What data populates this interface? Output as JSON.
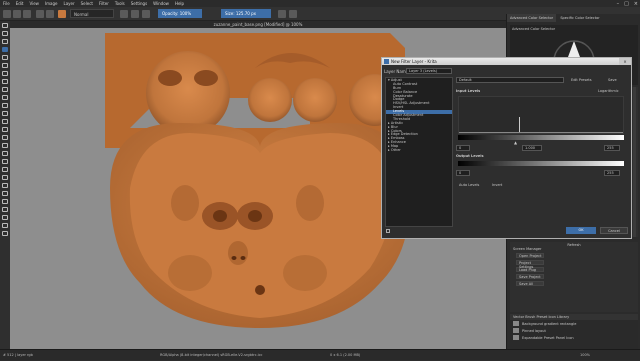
{
  "menu": [
    "File",
    "Edit",
    "View",
    "Image",
    "Layer",
    "Select",
    "Filter",
    "Tools",
    "Settings",
    "Window",
    "Help"
  ],
  "toolbar": {
    "blend_mode": "Normal",
    "opacity": "Opacity: 100%",
    "size": "Size: 125.70 px"
  },
  "document_tab": "zuzanne_paint_base.png [Modified] @ 100%",
  "dock": {
    "tabs": [
      "Advanced Color Selector",
      "Specific Color Selector"
    ],
    "color_title": "Advanced Color Selector",
    "refresh": "Refresh",
    "panel_title": "Screen Manager",
    "panel_buttons": [
      "Open Project",
      "Project Settings",
      "Load Plug",
      "Save Project",
      "Save All"
    ],
    "brush_title": "Vector Brush Preset Icon Library",
    "brushes": [
      "Background gradient rectangle",
      "Pinned layout",
      "Expandable Preset Panel Icon"
    ]
  },
  "status": {
    "left": "# 512 | layer rgb",
    "center": "RGB/Alpha (8-bit integer/channel) sRGB-elle-V2-srgbtrc.icc",
    "right": "0 x 6.1 (2.00 MB)",
    "zoom": "100%"
  },
  "dialog": {
    "title": "New Filter Layer - Krita",
    "layer_name_label": "Layer Name:",
    "layer_name": "Layer 3 (Levels)",
    "filters": [
      {
        "label": "Adjust",
        "cat": true
      },
      {
        "label": "Auto Contrast",
        "cat": false
      },
      {
        "label": "Burn",
        "cat": false
      },
      {
        "label": "Color Balance",
        "cat": false
      },
      {
        "label": "Desaturate",
        "cat": false
      },
      {
        "label": "Dodge",
        "cat": false
      },
      {
        "label": "HSV/HSL Adjustment",
        "cat": false
      },
      {
        "label": "Invert",
        "cat": false
      },
      {
        "label": "Levels",
        "cat": false,
        "sel": true
      },
      {
        "label": "Color Adjustment",
        "cat": false
      },
      {
        "label": "Threshold",
        "cat": false
      },
      {
        "label": "Artistic",
        "cat": true
      },
      {
        "label": "Blur",
        "cat": true
      },
      {
        "label": "Colors",
        "cat": true
      },
      {
        "label": "Edge Detection",
        "cat": true
      },
      {
        "label": "Emboss",
        "cat": true
      },
      {
        "label": "Enhance",
        "cat": true
      },
      {
        "label": "Map",
        "cat": true
      },
      {
        "label": "Other",
        "cat": true
      }
    ],
    "preset": "Default",
    "edit_presets": "Edit Presets",
    "save": "Save",
    "input_levels": "Input Levels",
    "logarithmic": "Logarithmic",
    "in_min": "0",
    "gamma": "1.000",
    "in_max": "255",
    "output_levels": "Output Levels",
    "out_min": "0",
    "out_max": "255",
    "auto_levels": "Auto Levels",
    "invert": "Invert",
    "ok": "OK",
    "cancel": "Cancel",
    "histogram_peak": 0.44
  },
  "colors": {
    "accent": "#3d6ea8",
    "skin": "#c97a3f",
    "canvas_bg": "#8e8e8e"
  }
}
